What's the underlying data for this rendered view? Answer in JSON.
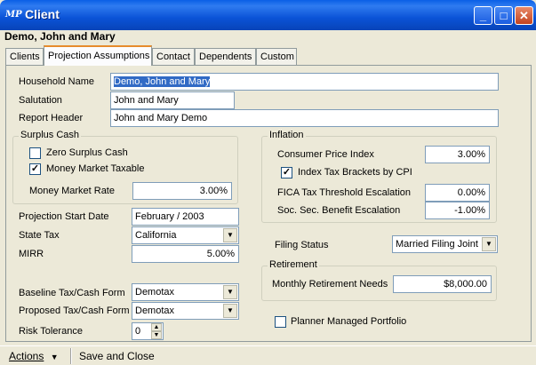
{
  "window": {
    "app_icon": "MP",
    "title": "Client",
    "client_name": "Demo, John and Mary",
    "minimize_icon": "minimize-icon",
    "maximize_icon": "maximize-icon",
    "close_icon": "close-icon"
  },
  "tabs": [
    "Clients",
    "Projection Assumptions",
    "Contact",
    "Dependents",
    "Custom"
  ],
  "active_tab": "Projection Assumptions",
  "fields": {
    "household_name_label": "Household Name",
    "household_name_value": "Demo, John and Mary",
    "salutation_label": "Salutation",
    "salutation_value": "John and Mary",
    "report_header_label": "Report Header",
    "report_header_value": "John and Mary Demo"
  },
  "surplus_cash": {
    "title": "Surplus Cash",
    "zero_surplus_label": "Zero Surplus Cash",
    "zero_surplus_checked": false,
    "money_market_taxable_label": "Money Market Taxable",
    "money_market_taxable_checked": true,
    "money_market_rate_label": "Money Market Rate",
    "money_market_rate_value": "3.00%"
  },
  "projection": {
    "start_date_label": "Projection Start Date",
    "start_date_value": "February / 2003",
    "state_tax_label": "State Tax",
    "state_tax_value": "California",
    "mirr_label": "MIRR",
    "mirr_value": "5.00%",
    "baseline_label": "Baseline Tax/Cash Form",
    "baseline_value": "Demotax",
    "proposed_label": "Proposed Tax/Cash Form",
    "proposed_value": "Demotax",
    "risk_label": "Risk Tolerance",
    "risk_value": "0"
  },
  "inflation": {
    "title": "Inflation",
    "cpi_label": "Consumer Price Index",
    "cpi_value": "3.00%",
    "index_brackets_label": "Index Tax Brackets by CPI",
    "index_brackets_checked": true,
    "fica_label": "FICA Tax Threshold Escalation",
    "fica_value": "0.00%",
    "ss_label": "Soc. Sec. Benefit Escalation",
    "ss_value": "-1.00%"
  },
  "filing": {
    "label": "Filing Status",
    "value": "Married Filing Joint"
  },
  "retirement": {
    "title": "Retirement",
    "needs_label": "Monthly Retirement Needs",
    "needs_value": "$8,000.00"
  },
  "planner_managed_label": "Planner Managed Portfolio",
  "planner_managed_checked": false,
  "statusbar": {
    "actions_label": "Actions",
    "save_close_label": "Save and Close"
  },
  "check_mark": "✓"
}
